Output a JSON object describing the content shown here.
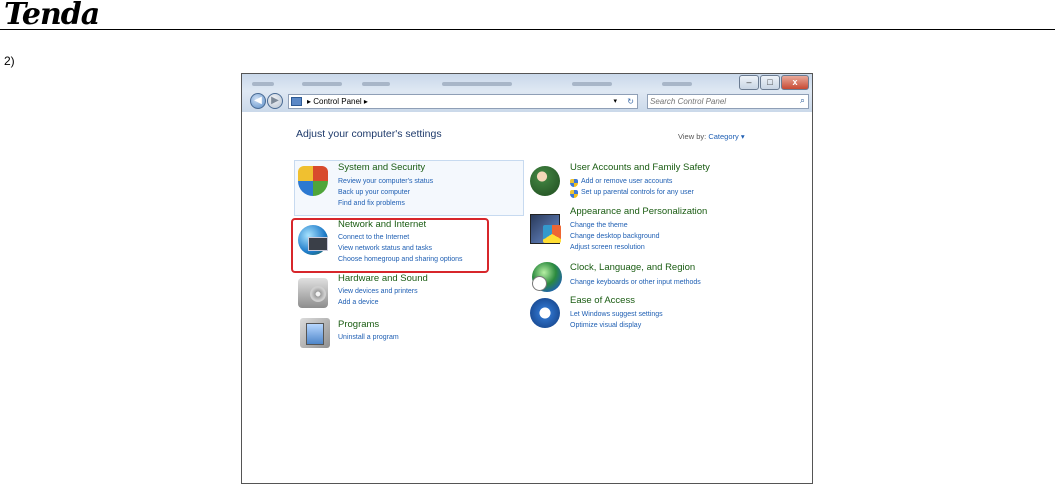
{
  "doc": {
    "logo_text": "Tenda",
    "step_label": "2)"
  },
  "window": {
    "buttons": {
      "minimize": "–",
      "maximize": "□",
      "close": "x"
    },
    "nav": {
      "back": "◀",
      "forward": "▶"
    },
    "address": {
      "crumb": "▸  Control Panel  ▸",
      "dropdown": "▾",
      "refresh": "↻"
    },
    "search": {
      "placeholder": "Search Control Panel",
      "icon": "search-icon"
    }
  },
  "main": {
    "heading": "Adjust your computer's settings",
    "view_by_label": "View by:",
    "view_by_value": "Category ▾"
  },
  "left_categories": [
    {
      "title": "System and Security",
      "icon": "system-security-shield-icon",
      "links": [
        "Review your computer's status",
        "Back up your computer",
        "Find and fix problems"
      ]
    },
    {
      "title": "Network and Internet",
      "icon": "network-globe-icon",
      "links": [
        "Connect to the Internet",
        "View network status and tasks",
        "Choose homegroup and sharing options"
      ]
    },
    {
      "title": "Hardware and Sound",
      "icon": "hardware-sound-icon",
      "links": [
        "View devices and printers",
        "Add a device"
      ]
    },
    {
      "title": "Programs",
      "icon": "programs-icon",
      "links": [
        "Uninstall a program"
      ]
    }
  ],
  "right_categories": [
    {
      "title": "User Accounts and Family Safety",
      "icon": "user-accounts-icon",
      "links": [
        "Add or remove user accounts",
        "Set up parental controls for any user"
      ]
    },
    {
      "title": "Appearance and Personalization",
      "icon": "appearance-icon",
      "links": [
        "Change the theme",
        "Change desktop background",
        "Adjust screen resolution"
      ]
    },
    {
      "title": "Clock, Language, and Region",
      "icon": "clock-globe-icon",
      "links": [
        "Change keyboards or other input methods"
      ]
    },
    {
      "title": "Ease of Access",
      "icon": "ease-of-access-icon",
      "links": [
        "Let Windows suggest settings",
        "Optimize visual display"
      ]
    }
  ],
  "colors": {
    "highlight_border": "#d7262b",
    "category_title": "#1a5c12",
    "link": "#1f5fb3"
  }
}
